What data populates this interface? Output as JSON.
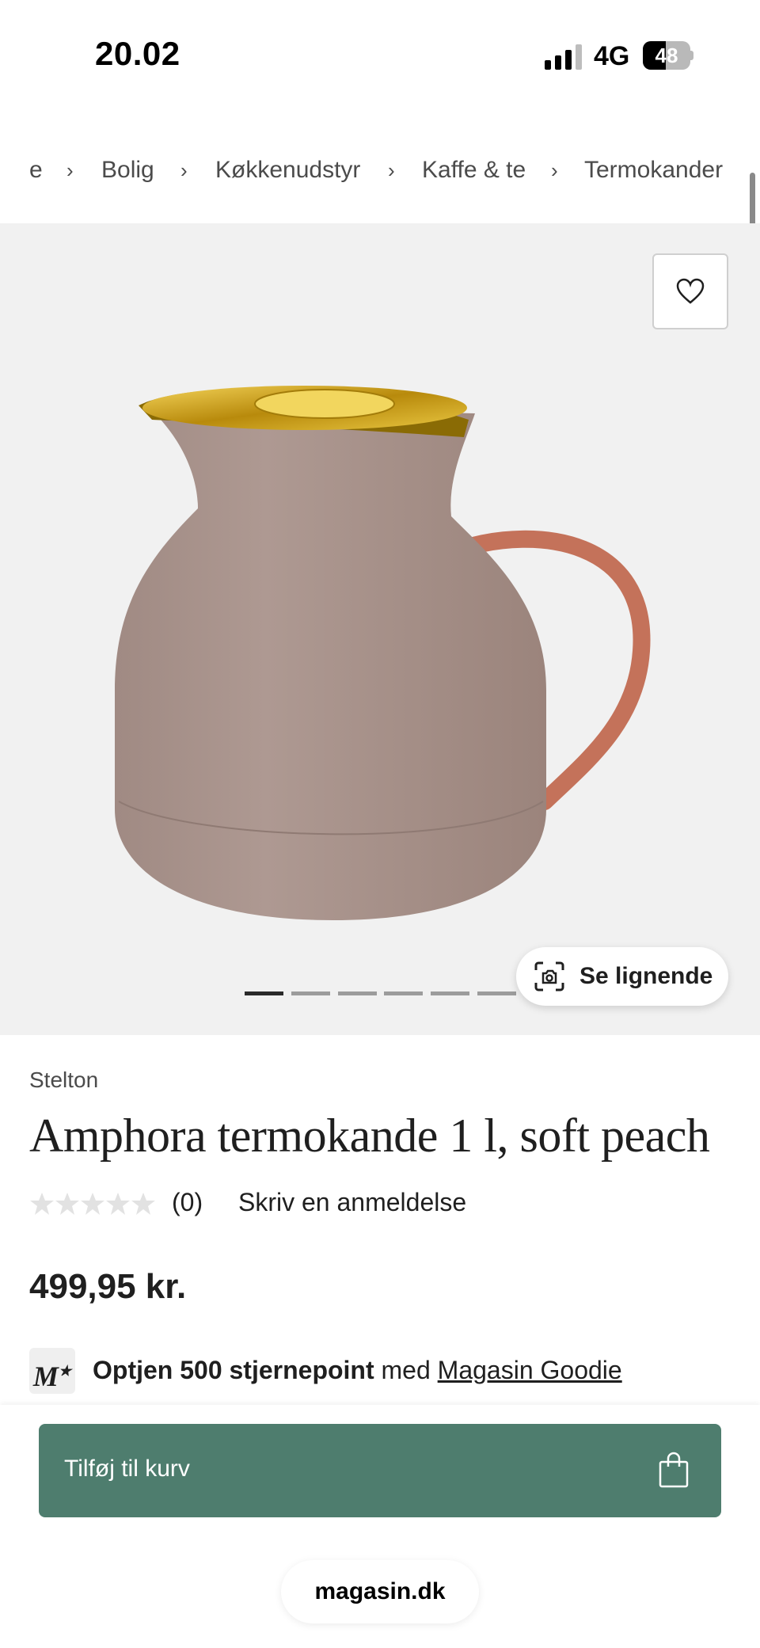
{
  "status_bar": {
    "time": "20.02",
    "network": "4G",
    "battery": "48",
    "battery_level": 0.48
  },
  "breadcrumb": [
    "e",
    "Bolig",
    "Køkkenudstyr",
    "Kaffe & te",
    "Termokander"
  ],
  "gallery": {
    "similar_label": "Se lignende",
    "slide_count": 6,
    "active_slide": 1
  },
  "product": {
    "brand": "Stelton",
    "title": "Amphora termokande 1 l, soft peach",
    "rating_count": "(0)",
    "rating_value": 0,
    "write_review": "Skriv en anmeldelse",
    "price": "499,95 kr."
  },
  "loyalty": {
    "logo": "M",
    "points_text": "Optjen 500 stjernepoint",
    "mid_text": "med",
    "link_text": "Magasin Goodie"
  },
  "cart": {
    "button_label": "Tilføj til kurv"
  },
  "browser": {
    "url": "magasin.dk"
  },
  "colors": {
    "accent": "#4e7d6e",
    "body": "#a48e87",
    "handle": "#c4725a",
    "lid": "#d4af2a"
  }
}
